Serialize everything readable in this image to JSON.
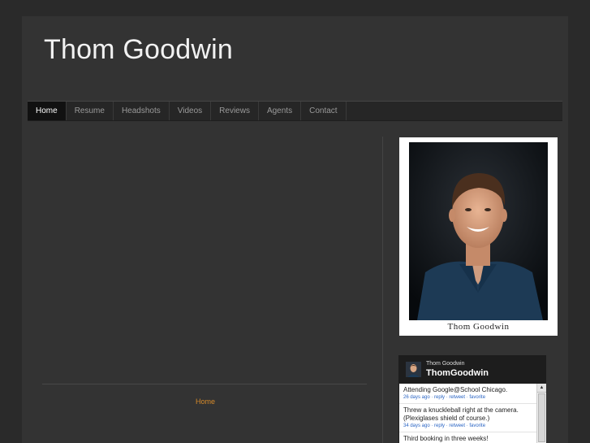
{
  "site": {
    "title": "Thom Goodwin"
  },
  "nav": {
    "items": [
      {
        "label": "Home",
        "active": true
      },
      {
        "label": "Resume",
        "active": false
      },
      {
        "label": "Headshots",
        "active": false
      },
      {
        "label": "Videos",
        "active": false
      },
      {
        "label": "Reviews",
        "active": false
      },
      {
        "label": "Agents",
        "active": false
      },
      {
        "label": "Contact",
        "active": false
      }
    ]
  },
  "footer": {
    "link": "Home"
  },
  "sidebar": {
    "headshot_caption": "Thom Goodwin",
    "twitter": {
      "name": "Thom Goodwin",
      "handle": "ThomGoodwin",
      "tweets": [
        {
          "text": "Attending Google@School Chicago.",
          "meta": "26 days ago · reply · retweet · favorite"
        },
        {
          "text": "Threw a knuckleball right at the camera. (Plexiglases shield of course.)",
          "meta": "34 days ago · reply · retweet · favorite"
        },
        {
          "text": "Third booking in three weeks!",
          "meta": ""
        }
      ]
    }
  },
  "colors": {
    "background": "#2a2a2a",
    "page": "#333333",
    "nav_active": "#111111",
    "link_accent": "#d68a2a",
    "tweet_link": "#2a65c4"
  }
}
